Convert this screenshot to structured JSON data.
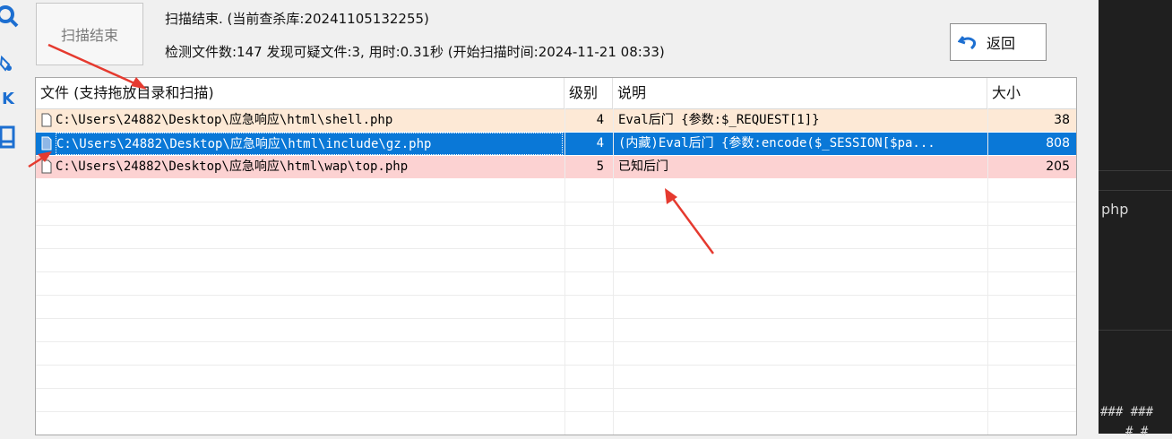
{
  "left_strip": {
    "letter": "K"
  },
  "scan_button": {
    "label": "扫描结束"
  },
  "status": {
    "line1": "扫描结束. (当前查杀库:20241105132255)",
    "line2": "检测文件数:147 发现可疑文件:3, 用时:0.31秒 (开始扫描时间:2024-11-21 08:33)"
  },
  "back_button": {
    "label": "返回"
  },
  "table": {
    "columns": [
      "文件 (支持拖放目录和扫描)",
      "级别",
      "说明",
      "大小"
    ],
    "rows": [
      {
        "file": "C:\\Users\\24882\\Desktop\\应急响应\\html\\shell.php",
        "level": "4",
        "desc": "Eval后门 {参数:$_REQUEST[1]}",
        "size": "38"
      },
      {
        "file": "C:\\Users\\24882\\Desktop\\应急响应\\html\\include\\gz.php",
        "level": "4",
        "desc": "(内藏)Eval后门 {参数:encode($_SESSION[$pa...",
        "size": "808"
      },
      {
        "file": "C:\\Users\\24882\\Desktop\\应急响应\\html\\wap\\top.php",
        "level": "5",
        "desc": "已知后门",
        "size": "205"
      }
    ],
    "row_colors": [
      "#fde9d6",
      "#0a78d7",
      "#fcd2d2"
    ]
  },
  "right_panel": {
    "text1": "php",
    "text2": "###  ###",
    "text3": "# #"
  },
  "colors": {
    "selected": "#0a78d7",
    "arrow": "#e53a2f",
    "accent_icon": "#1d6fd1"
  }
}
